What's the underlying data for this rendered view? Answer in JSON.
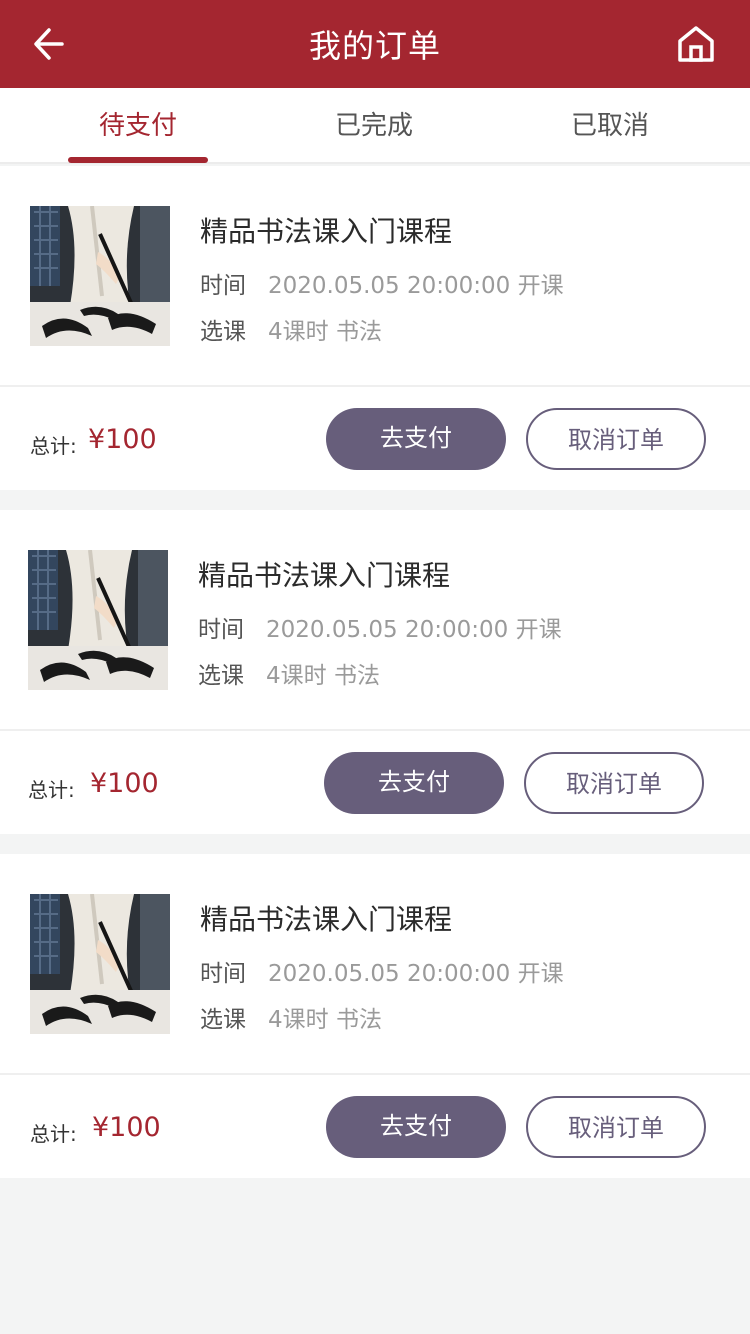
{
  "header": {
    "title": "我的订单",
    "back_icon": "arrow-left-icon",
    "home_icon": "home-icon"
  },
  "tabs": [
    {
      "label": "待支付",
      "active": true
    },
    {
      "label": "已完成",
      "active": false
    },
    {
      "label": "已取消",
      "active": false
    }
  ],
  "orders": [
    {
      "course_name": "精品书法课入门课程",
      "time_label": "时间",
      "time_value": "2020.05.05 20:00:00 开课",
      "select_label": "选课",
      "select_value": "4课时  书法",
      "total_label": "总计:",
      "total_value": "¥100",
      "pay_label": "去支付",
      "cancel_label": "取消订单"
    },
    {
      "course_name": "精品书法课入门课程",
      "time_label": "时间",
      "time_value": "2020.05.05 20:00:00 开课",
      "select_label": "选课",
      "select_value": "4课时  书法",
      "total_label": "总计:",
      "total_value": "¥100",
      "pay_label": "去支付",
      "cancel_label": "取消订单"
    },
    {
      "course_name": "精品书法课入门课程",
      "time_label": "时间",
      "time_value": "2020.05.05 20:00:00 开课",
      "select_label": "选课",
      "select_value": "4课时  书法",
      "total_label": "总计:",
      "total_value": "¥100",
      "pay_label": "去支付",
      "cancel_label": "取消订单"
    }
  ],
  "colors": {
    "brand": "#a42630",
    "button": "#675e7b",
    "background": "#f3f4f4"
  }
}
